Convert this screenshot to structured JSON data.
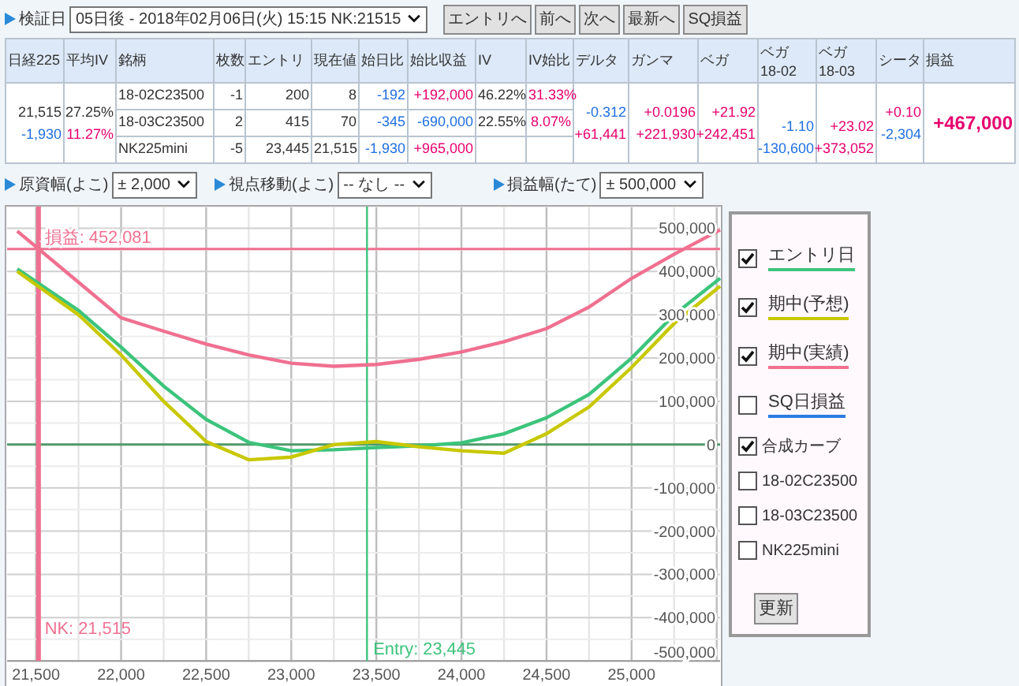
{
  "toolbar": {
    "label": "検証日",
    "date_select": "05日後 - 2018年02月06日(火) 15:15 NK:21515",
    "buttons": [
      "エントリへ",
      "前へ",
      "次へ",
      "最新へ",
      "SQ損益"
    ]
  },
  "table": {
    "columns": [
      {
        "label": "日経225"
      },
      {
        "label": "平均IV"
      },
      {
        "label": "銘柄"
      },
      {
        "label": "枚数"
      },
      {
        "label": "エントリ"
      },
      {
        "label": "現在値"
      },
      {
        "label": "始日比"
      },
      {
        "label": "始比収益"
      },
      {
        "label": "IV"
      },
      {
        "label": "IV始比"
      },
      {
        "label": "デルタ"
      },
      {
        "label": "ガンマ"
      },
      {
        "label": "ベガ"
      },
      {
        "label": "ベガ",
        "sub": "18-02"
      },
      {
        "label": "ベガ",
        "sub": "18-03"
      },
      {
        "label": "シータ"
      },
      {
        "label": "損益"
      }
    ],
    "nikkei": [
      {
        "text": "21,515"
      },
      {
        "text": "-1,930",
        "color": "#1f6fe0"
      }
    ],
    "avg_iv": [
      {
        "text": "27.25%"
      },
      {
        "text": "11.27%",
        "color": "#e6006e"
      }
    ],
    "rows": [
      {
        "name": "18-02C23500",
        "qty": "-1",
        "entry": "200",
        "price": "8",
        "day_change": {
          "text": "-192",
          "color": "#1f6fe0"
        },
        "pnl_change": {
          "text": "+192,000",
          "color": "#e6006e"
        },
        "iv": "46.22%",
        "iv_change": {
          "text": "31.33%",
          "color": "#e6006e"
        }
      },
      {
        "name": "18-03C23500",
        "qty": "2",
        "entry": "415",
        "price": "70",
        "day_change": {
          "text": "-345",
          "color": "#1f6fe0"
        },
        "pnl_change": {
          "text": "-690,000",
          "color": "#1f6fe0"
        },
        "iv": "22.55%",
        "iv_change": {
          "text": "8.07%",
          "color": "#e6006e"
        }
      },
      {
        "name": "NK225mini",
        "qty": "-5",
        "entry": "23,445",
        "price": "21,515",
        "day_change": {
          "text": "-1,930",
          "color": "#1f6fe0"
        },
        "pnl_change": {
          "text": "+965,000",
          "color": "#e6006e"
        }
      }
    ],
    "greeks": [
      {
        "kind": "total",
        "values": [
          {
            "text": "-0.312",
            "color": "#1f6fe0"
          },
          {
            "text": "+61,441",
            "color": "#e6006e"
          }
        ]
      },
      {
        "kind": "total",
        "values": [
          {
            "text": "+0.0196",
            "color": "#e6006e"
          },
          {
            "text": "+221,930",
            "color": "#e6006e"
          }
        ]
      },
      {
        "kind": "total",
        "values": [
          {
            "text": "+21.92",
            "color": "#e6006e"
          },
          {
            "text": "+242,451",
            "color": "#e6006e"
          }
        ]
      },
      {
        "kind": "month",
        "values": [
          {
            "text": "-1.10",
            "color": "#1f6fe0"
          },
          {
            "text": "-130,600",
            "color": "#1f6fe0"
          }
        ]
      },
      {
        "kind": "month",
        "values": [
          {
            "text": "+23.02",
            "color": "#e6006e"
          },
          {
            "text": "+373,052",
            "color": "#e6006e"
          }
        ]
      },
      {
        "kind": "total",
        "values": [
          {
            "text": "+0.10",
            "color": "#e6006e"
          },
          {
            "text": "-2,304",
            "color": "#1f6fe0"
          }
        ]
      }
    ],
    "pnl": {
      "text": "+467,000",
      "color": "#e6006e"
    }
  },
  "controls": [
    {
      "label": "原資幅(よこ)",
      "value": "± 2,000"
    },
    {
      "label": "視点移動(よこ)",
      "value": "-- なし --"
    },
    {
      "label": "損益幅(たて)",
      "value": "± 500,000"
    }
  ],
  "chart": {
    "chart_data": {
      "type": "line",
      "grid": true,
      "x": [
        21390,
        21750,
        22000,
        22250,
        22500,
        22750,
        23000,
        23250,
        23500,
        23750,
        24000,
        24250,
        24500,
        24750,
        25000,
        25250,
        25520
      ],
      "series": [
        {
          "name": "エントリ日",
          "color": "#3cc47c",
          "values": [
            406000,
            310000,
            225000,
            135000,
            58000,
            5000,
            -14000,
            -12000,
            -7000,
            -3000,
            4000,
            25000,
            62000,
            116000,
            200000,
            300000,
            384000
          ]
        },
        {
          "name": "期中(予想)",
          "color": "#c8c800",
          "values": [
            400000,
            300000,
            207000,
            100000,
            7000,
            -35000,
            -29000,
            0,
            7000,
            -5000,
            -14000,
            -20000,
            25000,
            87000,
            178000,
            280000,
            366000
          ]
        },
        {
          "name": "期中(実績)",
          "color": "#f07090",
          "values": [
            493000,
            375000,
            293000,
            262000,
            232000,
            207000,
            188000,
            181000,
            185000,
            197000,
            214000,
            238000,
            268000,
            318000,
            384000,
            440000,
            496000
          ]
        }
      ],
      "xlim": [
        21330,
        25520
      ],
      "ylim": [
        -500000,
        550000
      ],
      "xticks": [
        {
          "value": 21500,
          "label": "21,500"
        },
        {
          "value": 22000,
          "label": "22,000"
        },
        {
          "value": 22500,
          "label": "22,500"
        },
        {
          "value": 23000,
          "label": "23,000"
        },
        {
          "value": 23500,
          "label": "23,500"
        },
        {
          "value": 24000,
          "label": "24,000"
        },
        {
          "value": 24500,
          "label": "24,500"
        },
        {
          "value": 25000,
          "label": "25,000"
        }
      ],
      "yticks": [
        {
          "value": 500000,
          "label": "500,000"
        },
        {
          "value": 400000,
          "label": "400,000"
        },
        {
          "value": 300000,
          "label": "300,000"
        },
        {
          "value": 200000,
          "label": "200,000"
        },
        {
          "value": 100000,
          "label": "100,000"
        },
        {
          "value": 0,
          "label": "0"
        },
        {
          "value": -100000,
          "label": "-100,000"
        },
        {
          "value": -200000,
          "label": "-200,000"
        },
        {
          "value": -300000,
          "label": "-300,000"
        },
        {
          "value": -400000,
          "label": "-400,000"
        },
        {
          "value": -500000,
          "label": "-500,000"
        }
      ],
      "ref_lines": [
        {
          "axis": "y",
          "value": 0,
          "color": "#4f9a6a"
        },
        {
          "axis": "y",
          "value": 452081,
          "label": "損益: 452,081",
          "color": "#f07090"
        },
        {
          "axis": "x",
          "value": 21515,
          "label": "NK: 21,515",
          "color": "#f07090"
        },
        {
          "axis": "x",
          "value": 23445,
          "label": "Entry: 23,445",
          "color": "#3cc47c"
        }
      ]
    },
    "legend": {
      "items": [
        {
          "kind": "series",
          "checked": true
        },
        {
          "kind": "series",
          "checked": true
        },
        {
          "kind": "series",
          "checked": true
        },
        {
          "kind": "line",
          "label": "SQ日損益",
          "checked": false,
          "color": "#2a7de1"
        },
        {
          "kind": "plain",
          "label": "合成カーブ",
          "checked": true
        },
        {
          "kind": "plain",
          "label": "18-02C23500",
          "checked": false
        },
        {
          "kind": "plain",
          "label": "18-03C23500",
          "checked": false
        },
        {
          "kind": "plain",
          "label": "NK225mini",
          "checked": false
        }
      ],
      "button": "更新"
    }
  }
}
